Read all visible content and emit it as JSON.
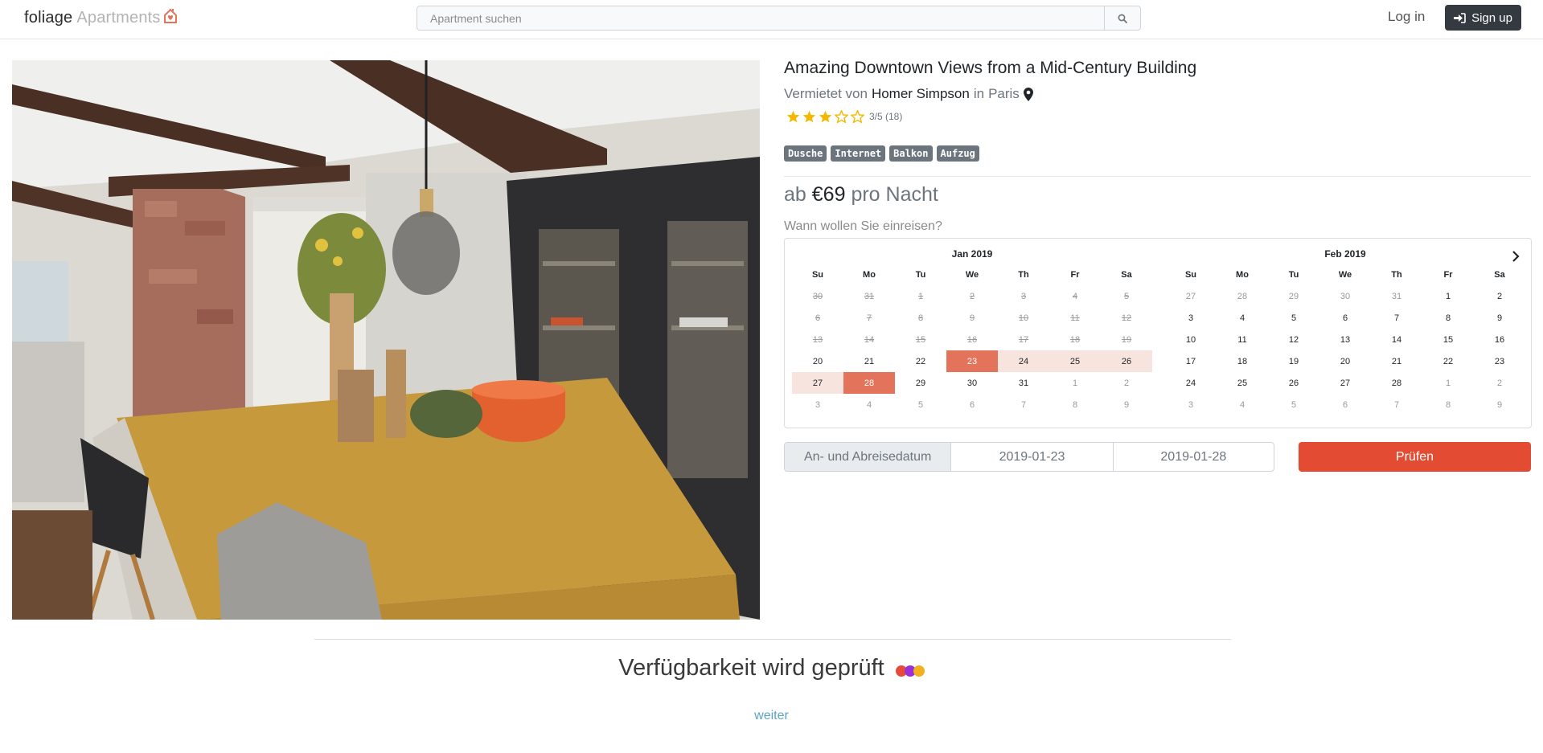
{
  "brand": {
    "part1": "foliage",
    "part2": "Apartments",
    "logo_icon": "house-heart-icon"
  },
  "search": {
    "placeholder": "Apartment suchen",
    "button_icon": "search-icon"
  },
  "nav": {
    "login": "Log in",
    "signup": "Sign up",
    "signup_icon": "sign-in-icon"
  },
  "listing": {
    "title": "Amazing Downtown Views from a Mid-Century Building",
    "host_prefix": "Vermietet von",
    "host_name": "Homer Simpson",
    "location_prefix": "in",
    "location": "Paris",
    "rating": {
      "filled_stars": 3,
      "total_stars": 5,
      "text": "3/5 (18)",
      "star_color": "#f5b800"
    },
    "tags": [
      "Dusche",
      "Internet",
      "Balkon",
      "Aufzug"
    ],
    "price": {
      "prefix": "ab",
      "amount": "€69",
      "suffix": "pro Nacht"
    },
    "question": "Wann wollen Sie einreisen?"
  },
  "calendar": {
    "weekdays": [
      "Su",
      "Mo",
      "Tu",
      "We",
      "Th",
      "Fr",
      "Sa"
    ],
    "months": [
      {
        "title": "Jan 2019",
        "weeks": [
          [
            {
              "d": "30",
              "s": "dis"
            },
            {
              "d": "31",
              "s": "dis"
            },
            {
              "d": "1",
              "s": "dis"
            },
            {
              "d": "2",
              "s": "dis"
            },
            {
              "d": "3",
              "s": "dis"
            },
            {
              "d": "4",
              "s": "dis"
            },
            {
              "d": "5",
              "s": "dis"
            }
          ],
          [
            {
              "d": "6",
              "s": "dis"
            },
            {
              "d": "7",
              "s": "dis"
            },
            {
              "d": "8",
              "s": "dis"
            },
            {
              "d": "9",
              "s": "dis"
            },
            {
              "d": "10",
              "s": "dis"
            },
            {
              "d": "11",
              "s": "dis"
            },
            {
              "d": "12",
              "s": "dis"
            }
          ],
          [
            {
              "d": "13",
              "s": "dis"
            },
            {
              "d": "14",
              "s": "dis"
            },
            {
              "d": "15",
              "s": "dis"
            },
            {
              "d": "16",
              "s": "dis"
            },
            {
              "d": "17",
              "s": "dis"
            },
            {
              "d": "18",
              "s": "dis"
            },
            {
              "d": "19",
              "s": "dis"
            }
          ],
          [
            {
              "d": "20",
              "s": ""
            },
            {
              "d": "21",
              "s": ""
            },
            {
              "d": "22",
              "s": ""
            },
            {
              "d": "23",
              "s": "sel"
            },
            {
              "d": "24",
              "s": "range"
            },
            {
              "d": "25",
              "s": "range"
            },
            {
              "d": "26",
              "s": "range"
            }
          ],
          [
            {
              "d": "27",
              "s": "range"
            },
            {
              "d": "28",
              "s": "sel"
            },
            {
              "d": "29",
              "s": ""
            },
            {
              "d": "30",
              "s": ""
            },
            {
              "d": "31",
              "s": ""
            },
            {
              "d": "1",
              "s": "old"
            },
            {
              "d": "2",
              "s": "old"
            }
          ],
          [
            {
              "d": "3",
              "s": "old"
            },
            {
              "d": "4",
              "s": "old"
            },
            {
              "d": "5",
              "s": "old"
            },
            {
              "d": "6",
              "s": "old"
            },
            {
              "d": "7",
              "s": "old"
            },
            {
              "d": "8",
              "s": "old"
            },
            {
              "d": "9",
              "s": "old"
            }
          ]
        ]
      },
      {
        "title": "Feb 2019",
        "weeks": [
          [
            {
              "d": "27",
              "s": "old"
            },
            {
              "d": "28",
              "s": "old"
            },
            {
              "d": "29",
              "s": "old"
            },
            {
              "d": "30",
              "s": "old"
            },
            {
              "d": "31",
              "s": "old"
            },
            {
              "d": "1",
              "s": ""
            },
            {
              "d": "2",
              "s": ""
            }
          ],
          [
            {
              "d": "3",
              "s": ""
            },
            {
              "d": "4",
              "s": ""
            },
            {
              "d": "5",
              "s": ""
            },
            {
              "d": "6",
              "s": ""
            },
            {
              "d": "7",
              "s": ""
            },
            {
              "d": "8",
              "s": ""
            },
            {
              "d": "9",
              "s": ""
            }
          ],
          [
            {
              "d": "10",
              "s": ""
            },
            {
              "d": "11",
              "s": ""
            },
            {
              "d": "12",
              "s": ""
            },
            {
              "d": "13",
              "s": ""
            },
            {
              "d": "14",
              "s": ""
            },
            {
              "d": "15",
              "s": ""
            },
            {
              "d": "16",
              "s": ""
            }
          ],
          [
            {
              "d": "17",
              "s": ""
            },
            {
              "d": "18",
              "s": ""
            },
            {
              "d": "19",
              "s": ""
            },
            {
              "d": "20",
              "s": ""
            },
            {
              "d": "21",
              "s": ""
            },
            {
              "d": "22",
              "s": ""
            },
            {
              "d": "23",
              "s": ""
            }
          ],
          [
            {
              "d": "24",
              "s": ""
            },
            {
              "d": "25",
              "s": ""
            },
            {
              "d": "26",
              "s": ""
            },
            {
              "d": "27",
              "s": ""
            },
            {
              "d": "28",
              "s": ""
            },
            {
              "d": "1",
              "s": "old"
            },
            {
              "d": "2",
              "s": "old"
            }
          ],
          [
            {
              "d": "3",
              "s": "old"
            },
            {
              "d": "4",
              "s": "old"
            },
            {
              "d": "5",
              "s": "old"
            },
            {
              "d": "6",
              "s": "old"
            },
            {
              "d": "7",
              "s": "old"
            },
            {
              "d": "8",
              "s": "old"
            },
            {
              "d": "9",
              "s": "old"
            }
          ]
        ]
      }
    ],
    "next_icon": "chevron-right-icon"
  },
  "booking": {
    "label": "An- und Abreisedatum",
    "start": "2019-01-23",
    "end": "2019-01-28",
    "check_button": "Prüfen",
    "accent": "#e34b32"
  },
  "availability": {
    "text": "Verfügbarkeit wird geprüft",
    "dot_colors": [
      "#e64a3b",
      "#9b30d6",
      "#f2b01e"
    ],
    "more_link": "weiter"
  }
}
